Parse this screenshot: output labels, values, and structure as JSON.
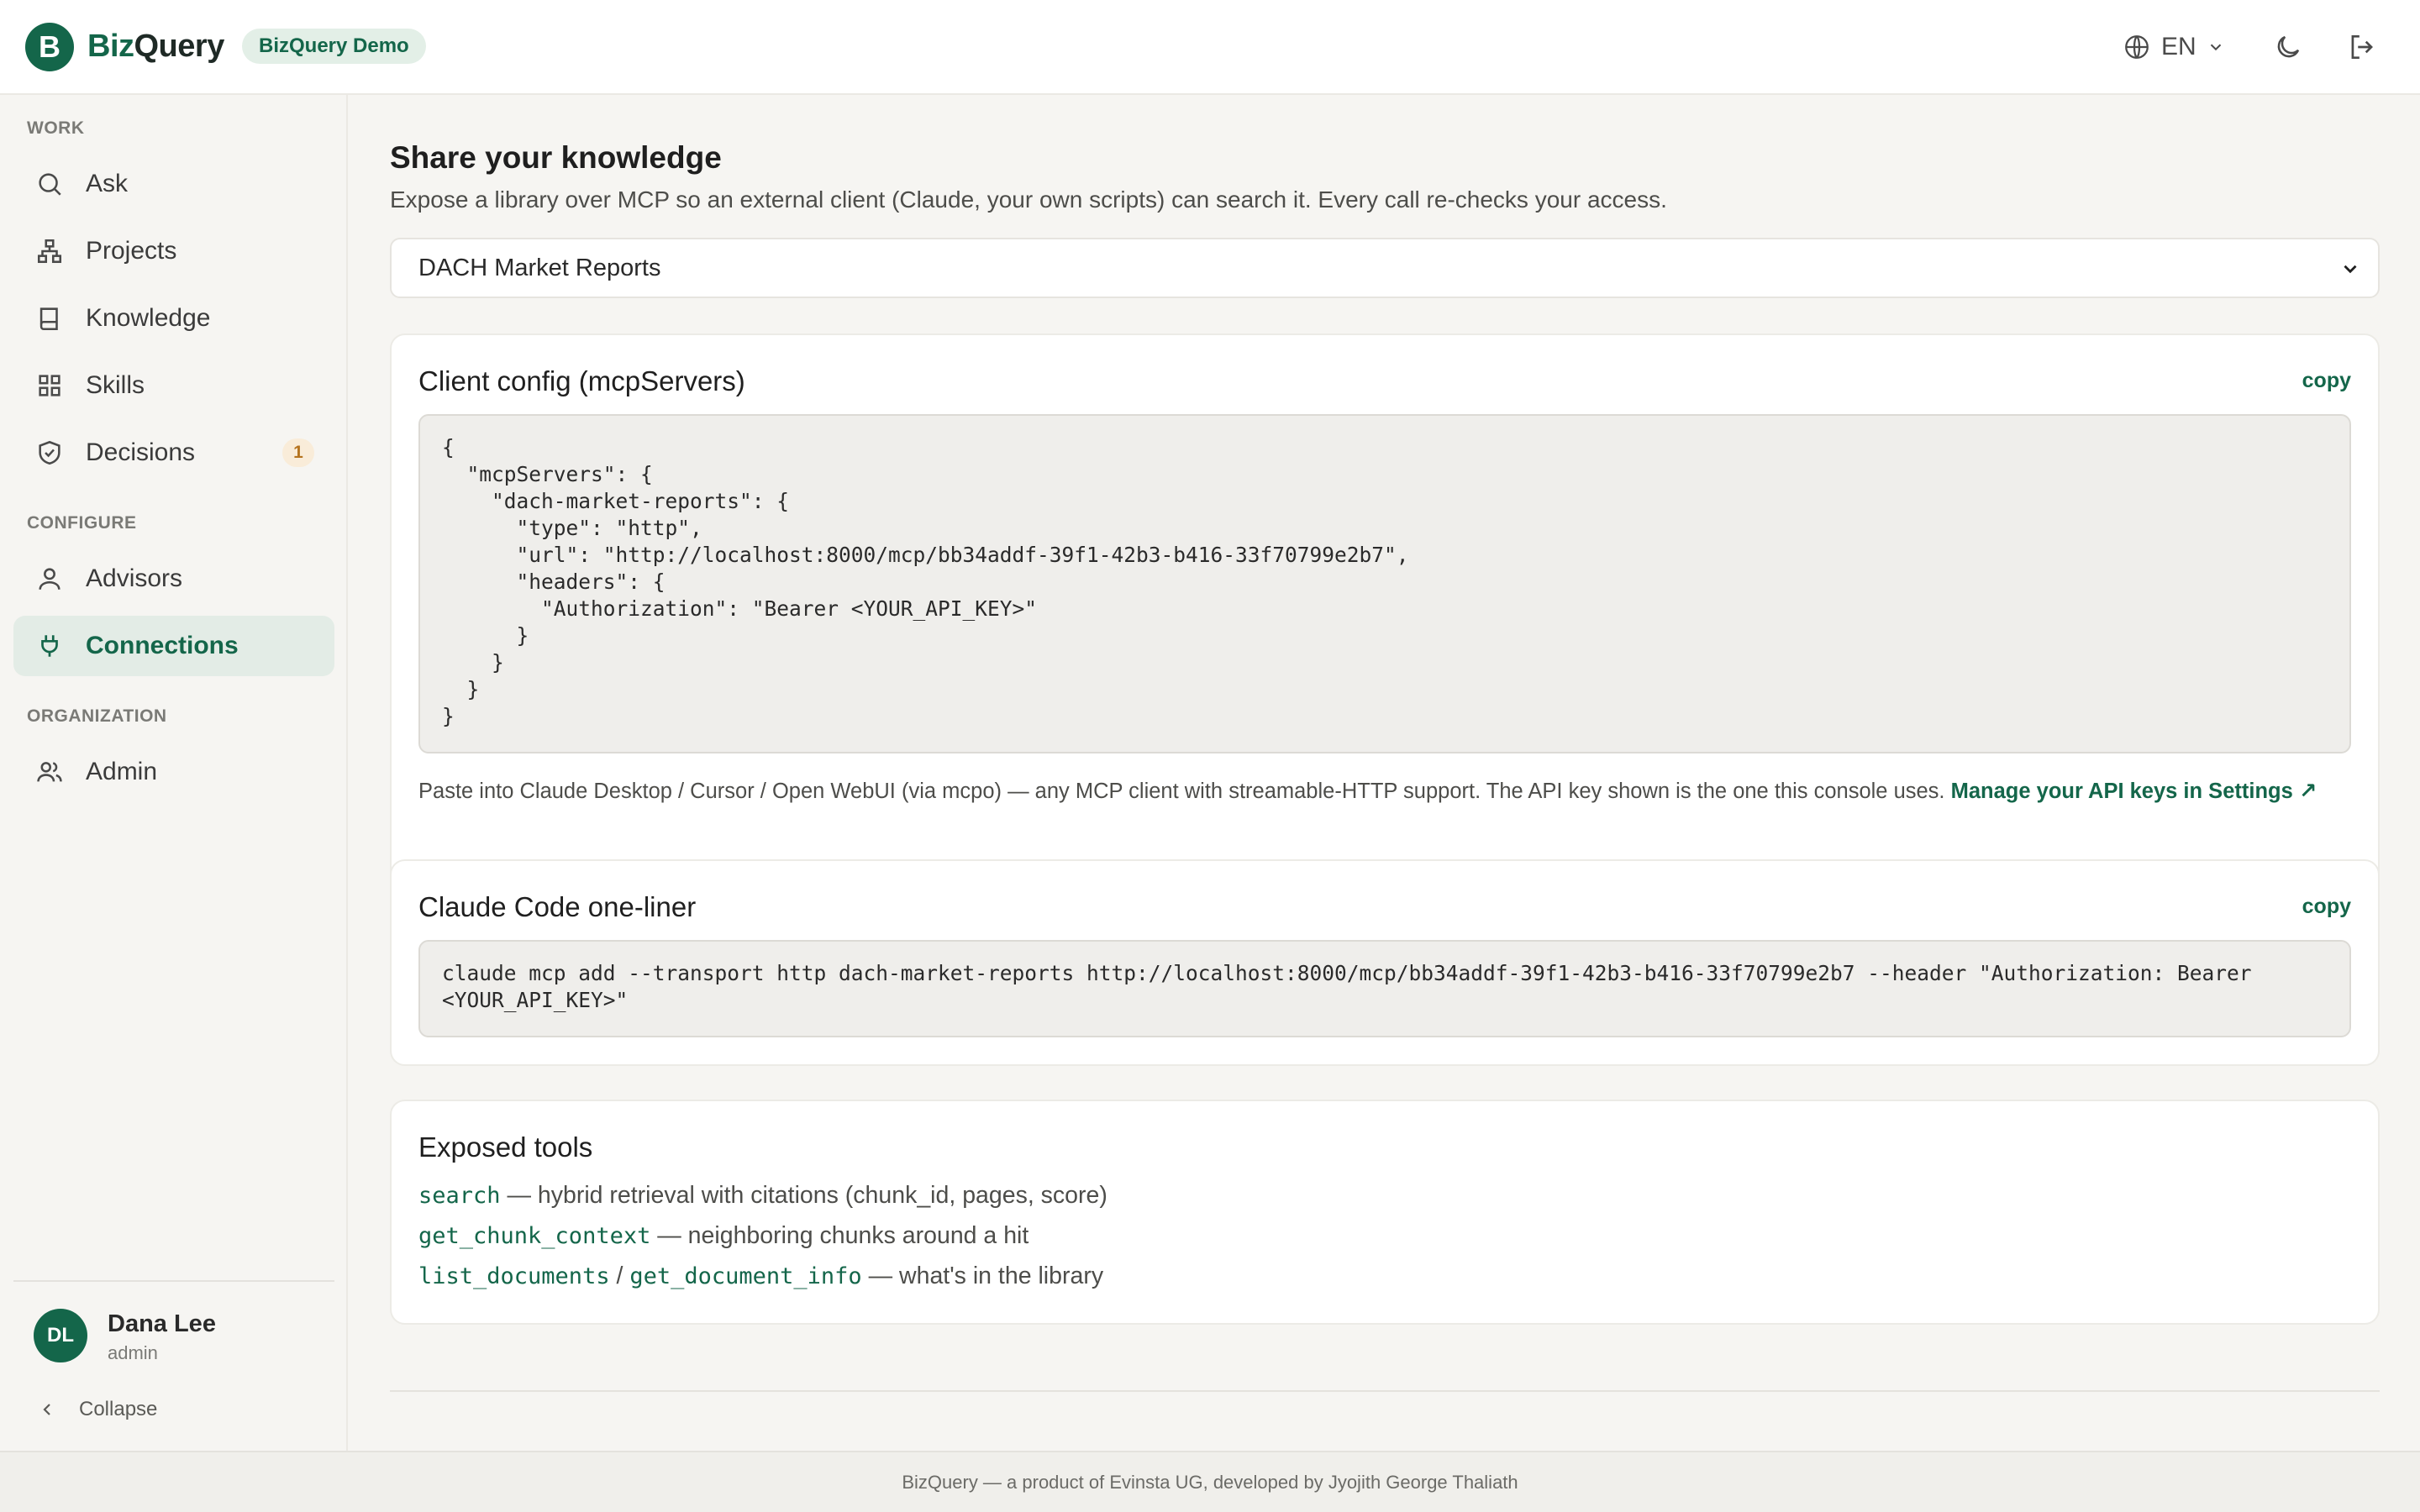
{
  "header": {
    "logo_letter": "B",
    "brand_prefix": "Biz",
    "brand_suffix": "Query",
    "demo_badge": "BizQuery Demo",
    "language": "EN",
    "icons": [
      "globe-icon",
      "chevron-down-icon",
      "moon-icon",
      "logout-icon"
    ]
  },
  "sidebar": {
    "sections": {
      "work": "WORK",
      "configure": "CONFIGURE",
      "organization": "ORGANIZATION"
    },
    "items": [
      {
        "label": "Ask",
        "icon": "search-icon"
      },
      {
        "label": "Projects",
        "icon": "sitemap-icon"
      },
      {
        "label": "Knowledge",
        "icon": "book-icon"
      },
      {
        "label": "Skills",
        "icon": "grid-icon"
      },
      {
        "label": "Decisions",
        "icon": "shield-check-icon",
        "badge": "1"
      },
      {
        "label": "Advisors",
        "icon": "user-icon"
      },
      {
        "label": "Connections",
        "icon": "plug-icon",
        "active": true
      },
      {
        "label": "Admin",
        "icon": "users-icon"
      }
    ],
    "user": {
      "initials": "DL",
      "name": "Dana Lee",
      "role": "admin"
    },
    "collapse_label": "Collapse"
  },
  "main": {
    "title": "Share your knowledge",
    "subtitle": "Expose a library over MCP so an external client (Claude, your own scripts) can search it. Every call re-checks your access.",
    "library_select": {
      "value": "DACH Market Reports"
    },
    "client_config": {
      "title": "Client config (mcpServers)",
      "copy_label": "copy",
      "code": "{\n  \"mcpServers\": {\n    \"dach-market-reports\": {\n      \"type\": \"http\",\n      \"url\": \"http://localhost:8000/mcp/bb34addf-39f1-42b3-b416-33f70799e2b7\",\n      \"headers\": {\n        \"Authorization\": \"Bearer <YOUR_API_KEY>\"\n      }\n    }\n  }\n}",
      "note": "Paste into Claude Desktop / Cursor / Open WebUI (via mcpo) — any MCP client with streamable-HTTP support. The API key shown is the one this console uses.",
      "link": "Manage your API keys in Settings ↗"
    },
    "one_liner": {
      "title": "Claude Code one-liner",
      "copy_label": "copy",
      "code": "claude mcp add --transport http dach-market-reports http://localhost:8000/mcp/bb34addf-39f1-42b3-b416-33f70799e2b7 --header \"Authorization: Bearer <YOUR_API_KEY>\""
    },
    "tools": {
      "title": "Exposed tools",
      "search": {
        "name": "search",
        "desc": " — hybrid retrieval with citations (chunk_id, pages, score)"
      },
      "chunk": {
        "name": "get_chunk_context",
        "desc": " — neighboring chunks around a hit"
      },
      "docs": {
        "name_a": "list_documents",
        "sep": " / ",
        "name_b": "get_document_info",
        "desc": " — what's in the library"
      }
    }
  },
  "footer": {
    "text": "BizQuery — a product of Evinsta UG, developed by Jyojith George Thaliath"
  },
  "colors": {
    "accent": "#14664a",
    "background": "#f6f5f2",
    "badge": "#b5731f"
  }
}
